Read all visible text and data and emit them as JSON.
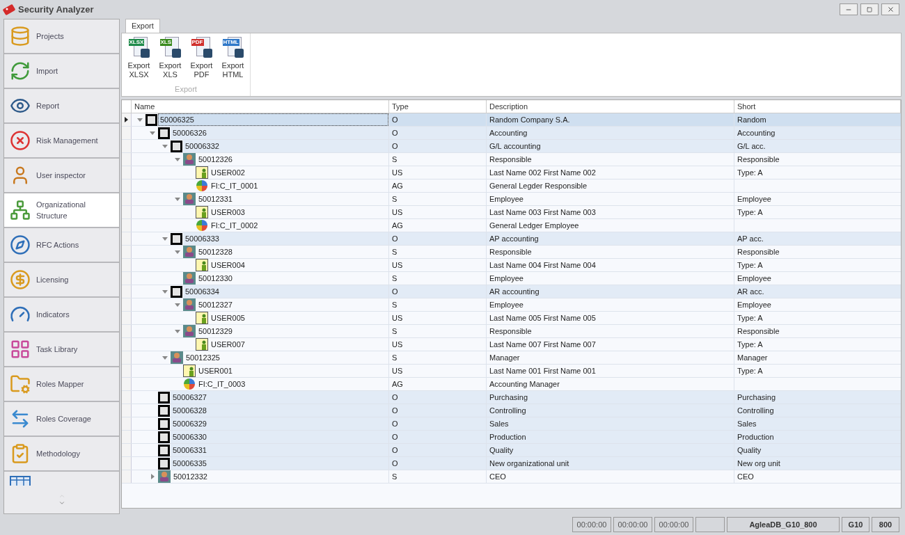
{
  "window": {
    "title": "Security Analyzer"
  },
  "sidebar": {
    "items": [
      {
        "label": "Projects",
        "selected": false
      },
      {
        "label": "Import",
        "selected": false
      },
      {
        "label": "Report",
        "selected": false
      },
      {
        "label": "Risk Management",
        "selected": false
      },
      {
        "label": "User inspector",
        "selected": false
      },
      {
        "label": "Organizational Structure",
        "selected": true
      },
      {
        "label": "RFC Actions",
        "selected": false
      },
      {
        "label": "Licensing",
        "selected": false
      },
      {
        "label": "Indicators",
        "selected": false
      },
      {
        "label": "Task Library",
        "selected": false
      },
      {
        "label": "Roles Mapper",
        "selected": false
      },
      {
        "label": "Roles Coverage",
        "selected": false
      },
      {
        "label": "Methodology",
        "selected": false
      },
      {
        "selected": false
      }
    ]
  },
  "ribbon": {
    "tabs": [
      {
        "label": "Export",
        "selected": true
      }
    ],
    "buttons": [
      {
        "badge": "XLSX",
        "color": "#1e8a4a",
        "line1": "Export",
        "line2": "XLSX"
      },
      {
        "badge": "XLS",
        "color": "#3a8a1e",
        "line1": "Export",
        "line2": "XLS"
      },
      {
        "badge": "PDF",
        "color": "#d0312d",
        "line1": "Export",
        "line2": "PDF"
      },
      {
        "badge": "HTML",
        "color": "#2f78c8",
        "line1": "Export",
        "line2": "HTML"
      }
    ],
    "group_label": "Export"
  },
  "tree": {
    "columns": [
      "Name",
      "Type",
      "Description",
      "Short"
    ],
    "rows": [
      {
        "kind": "org",
        "name": "50006325",
        "type": "O",
        "description": "Random Company S.A.",
        "short": "Random",
        "expanded": true,
        "selected": true,
        "children": [
          {
            "kind": "org",
            "name": "50006326",
            "type": "O",
            "description": "Accounting",
            "short": "Accounting",
            "expanded": true,
            "selected": false,
            "children": [
              {
                "kind": "org",
                "name": "50006332",
                "type": "O",
                "description": "G/L accounting",
                "short": "G/L acc.",
                "expanded": true,
                "selected": false,
                "children": [
                  {
                    "kind": "position",
                    "name": "50012326",
                    "type": "S",
                    "description": "Responsible",
                    "short": "Responsible",
                    "expanded": true,
                    "selected": false,
                    "children": [
                      {
                        "kind": "user",
                        "name": "USER002",
                        "type": "US",
                        "description": "Last Name 002 First Name 002",
                        "short": "Type: A",
                        "selected": false
                      },
                      {
                        "kind": "role",
                        "name": "FI:C_IT_0001",
                        "type": "AG",
                        "description": "General Legder Responsible",
                        "selected": false
                      }
                    ]
                  },
                  {
                    "kind": "position",
                    "name": "50012331",
                    "type": "S",
                    "description": "Employee",
                    "short": "Employee",
                    "expanded": true,
                    "selected": false,
                    "children": [
                      {
                        "kind": "user",
                        "name": "USER003",
                        "type": "US",
                        "description": "Last Name 003 First Name 003",
                        "short": "Type: A",
                        "selected": false
                      },
                      {
                        "kind": "role",
                        "name": "FI:C_IT_0002",
                        "type": "AG",
                        "description": "General Ledger Employee",
                        "selected": false
                      }
                    ]
                  }
                ]
              },
              {
                "kind": "org",
                "name": "50006333",
                "type": "O",
                "description": "AP accounting",
                "short": "AP acc.",
                "expanded": true,
                "selected": false,
                "children": [
                  {
                    "kind": "position",
                    "name": "50012328",
                    "type": "S",
                    "description": "Responsible",
                    "short": "Responsible",
                    "expanded": true,
                    "selected": false,
                    "children": [
                      {
                        "kind": "user",
                        "name": "USER004",
                        "type": "US",
                        "description": "Last Name 004 First Name 004",
                        "short": "Type: A",
                        "selected": false
                      }
                    ]
                  },
                  {
                    "kind": "position",
                    "name": "50012330",
                    "type": "S",
                    "description": "Employee",
                    "short": "Employee",
                    "selected": false
                  }
                ]
              },
              {
                "kind": "org",
                "name": "50006334",
                "type": "O",
                "description": "AR accounting",
                "short": "AR acc.",
                "expanded": true,
                "selected": false,
                "children": [
                  {
                    "kind": "position",
                    "name": "50012327",
                    "type": "S",
                    "description": "Employee",
                    "short": "Employee",
                    "expanded": true,
                    "selected": false,
                    "children": [
                      {
                        "kind": "user",
                        "name": "USER005",
                        "type": "US",
                        "description": "Last Name 005 First Name 005",
                        "short": "Type: A",
                        "selected": false
                      }
                    ]
                  },
                  {
                    "kind": "position",
                    "name": "50012329",
                    "type": "S",
                    "description": "Responsible",
                    "short": "Responsible",
                    "expanded": true,
                    "selected": false,
                    "children": [
                      {
                        "kind": "user",
                        "name": "USER007",
                        "type": "US",
                        "description": "Last Name 007 First Name 007",
                        "short": "Type: A",
                        "selected": false
                      }
                    ]
                  }
                ]
              },
              {
                "kind": "position",
                "name": "50012325",
                "type": "S",
                "description": "Manager",
                "short": "Manager",
                "expanded": true,
                "selected": false,
                "children": [
                  {
                    "kind": "user",
                    "name": "USER001",
                    "type": "US",
                    "description": "Last Name 001 First Name 001",
                    "short": "Type: A",
                    "selected": false
                  },
                  {
                    "kind": "role",
                    "name": "FI:C_IT_0003",
                    "type": "AG",
                    "description": "Accounting Manager",
                    "selected": false
                  }
                ]
              }
            ]
          },
          {
            "kind": "org",
            "name": "50006327",
            "type": "O",
            "description": "Purchasing",
            "short": "Purchasing",
            "selected": false
          },
          {
            "kind": "org",
            "name": "50006328",
            "type": "O",
            "description": "Controlling",
            "short": "Controlling",
            "selected": false
          },
          {
            "kind": "org",
            "name": "50006329",
            "type": "O",
            "description": "Sales",
            "short": "Sales",
            "selected": false
          },
          {
            "kind": "org",
            "name": "50006330",
            "type": "O",
            "description": "Production",
            "short": "Production",
            "selected": false
          },
          {
            "kind": "org",
            "name": "50006331",
            "type": "O",
            "description": "Quality",
            "short": "Quality",
            "selected": false
          },
          {
            "kind": "org",
            "name": "50006335",
            "type": "O",
            "description": "New organizational unit",
            "short": "New org unit",
            "selected": false
          },
          {
            "kind": "position",
            "name": "50012332",
            "type": "S",
            "description": "CEO",
            "short": "CEO",
            "expanded": false,
            "selected": false
          }
        ]
      }
    ]
  },
  "status_bar": {
    "timers": [
      "00:00:00",
      "00:00:00",
      "00:00:00"
    ],
    "database": "AgleaDB_G10_800",
    "system": "G10",
    "client": "800"
  }
}
